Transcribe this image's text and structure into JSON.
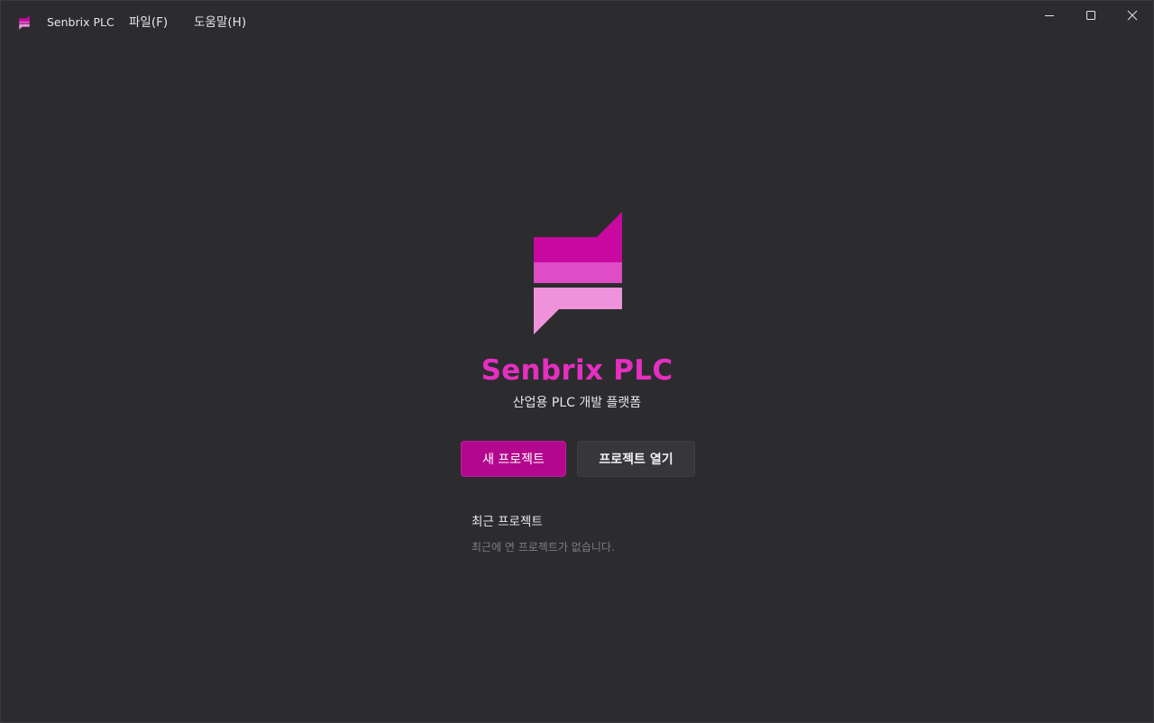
{
  "window": {
    "title": "Senbrix PLC",
    "menu": [
      {
        "label": "파일(F)"
      },
      {
        "label": "도움말(H)"
      }
    ],
    "controls": {
      "minimize_icon": "minimize-icon",
      "maximize_icon": "maximize-icon",
      "close_icon": "close-icon"
    }
  },
  "hero": {
    "logo_icon": "senbrix-logo-icon",
    "title": "Senbrix PLC",
    "subtitle": "산업용 PLC 개발 플랫폼"
  },
  "actions": {
    "new_project_label": "새 프로젝트",
    "open_project_label": "프로젝트 열기"
  },
  "recent": {
    "heading": "최근 프로젝트",
    "empty_message": "최근에 연 프로젝트가 없습니다."
  },
  "colors": {
    "background": "#2c2c2f",
    "brand_magenta": "#c8089f",
    "brand_mid": "#de4cc6",
    "brand_light": "#ef92dc",
    "title_text": "#e52fc0",
    "primary_button": "#b3088e",
    "secondary_button": "#37373b",
    "muted_text": "#7c7c82"
  }
}
